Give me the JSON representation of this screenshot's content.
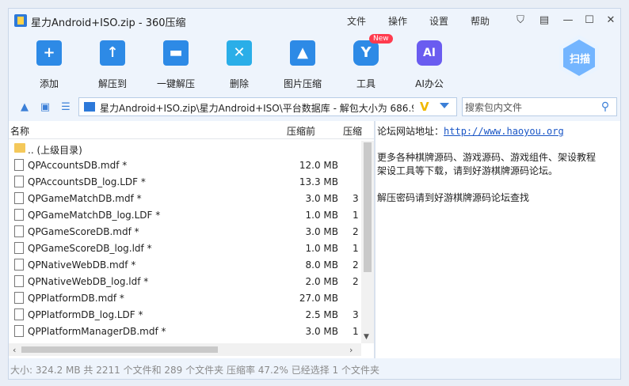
{
  "window": {
    "title": "星力Android+ISO.zip - 360压缩"
  },
  "menu": [
    "文件",
    "操作",
    "设置",
    "帮助"
  ],
  "toolbar": {
    "tools": [
      {
        "label": "添加",
        "icon": "add-icon",
        "glyph": "+"
      },
      {
        "label": "解压到",
        "icon": "extract-to-icon",
        "glyph": "↑"
      },
      {
        "label": "一键解压",
        "icon": "one-click-extract-icon",
        "glyph": "▬"
      },
      {
        "label": "删除",
        "icon": "delete-icon",
        "glyph": "✕"
      },
      {
        "label": "图片压缩",
        "icon": "image-compress-icon",
        "glyph": "▲"
      },
      {
        "label": "工具",
        "icon": "tools-icon",
        "glyph": "Y"
      },
      {
        "label": "AI办公",
        "icon": "ai-office-icon",
        "glyph": "AI"
      }
    ],
    "new_badge": "New",
    "scan_label": "扫描"
  },
  "address": {
    "path": "星力Android+ISO.zip\\星力Android+ISO\\平台数据库 - 解包大小为 686.9",
    "search_placeholder": "搜索包内文件"
  },
  "list": {
    "headers": {
      "name": "名称",
      "before": "压缩前",
      "after": "压缩"
    },
    "rows": [
      {
        "name": ".. (上级目录)",
        "size": "",
        "cp": "",
        "type": "folder"
      },
      {
        "name": "QPAccountsDB.mdf *",
        "size": "12.0 MB",
        "cp": "",
        "type": "file"
      },
      {
        "name": "QPAccountsDB_log.LDF *",
        "size": "13.3 MB",
        "cp": "",
        "type": "file"
      },
      {
        "name": "QPGameMatchDB.mdf *",
        "size": "3.0 MB",
        "cp": "3",
        "type": "file"
      },
      {
        "name": "QPGameMatchDB_log.LDF *",
        "size": "1.0 MB",
        "cp": "1",
        "type": "file"
      },
      {
        "name": "QPGameScoreDB.mdf *",
        "size": "3.0 MB",
        "cp": "2",
        "type": "file"
      },
      {
        "name": "QPGameScoreDB_log.ldf *",
        "size": "1.0 MB",
        "cp": "1",
        "type": "file"
      },
      {
        "name": "QPNativeWebDB.mdf *",
        "size": "8.0 MB",
        "cp": "2",
        "type": "file"
      },
      {
        "name": "QPNativeWebDB_log.ldf *",
        "size": "2.0 MB",
        "cp": "2",
        "type": "file"
      },
      {
        "name": "QPPlatformDB.mdf *",
        "size": "27.0 MB",
        "cp": "",
        "type": "file"
      },
      {
        "name": "QPPlatformDB_log.LDF *",
        "size": "2.5 MB",
        "cp": "3",
        "type": "file"
      },
      {
        "name": "QPPlatformManagerDB.mdf *",
        "size": "3.0 MB",
        "cp": "1",
        "type": "file"
      }
    ]
  },
  "comment": {
    "site_label": "论坛网站地址：",
    "site_url": "http://www.haoyou.org",
    "line2": "更多各种棋牌源码、游戏源码、游戏组件、架设教程",
    "line3": "架设工具等下载，请到好游棋牌源码论坛。",
    "line4": "解压密码请到好游棋牌源码论坛查找"
  },
  "status": "大小: 324.2 MB 共 2211 个文件和 289 个文件夹 压缩率 47.2% 已经选择 1 个文件夹"
}
